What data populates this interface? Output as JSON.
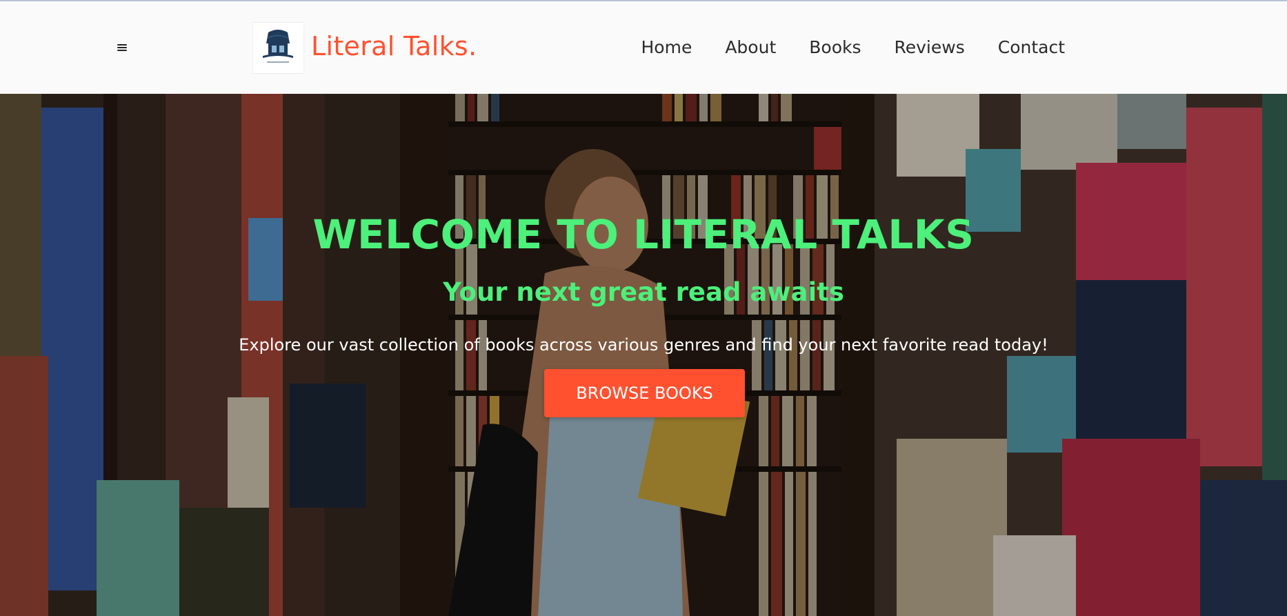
{
  "header": {
    "menu_icon": "hamburger-menu-icon",
    "logo_icon": "bookstore-logo-icon",
    "brand": "Literal Talks.",
    "nav": [
      {
        "label": "Home"
      },
      {
        "label": "About"
      },
      {
        "label": "Books"
      },
      {
        "label": "Reviews"
      },
      {
        "label": "Contact"
      }
    ]
  },
  "hero": {
    "title": "WELCOME TO LITERAL TALKS",
    "subtitle": "Your next great read awaits",
    "description": "Explore our vast collection of books across various genres and find your next favorite read today!",
    "button_label": "BROWSE BOOKS"
  },
  "colors": {
    "accent": "#ff5130",
    "hero_text": "#4cf07a",
    "header_bg": "#fafafa",
    "nav_text": "#2b2b2b"
  }
}
